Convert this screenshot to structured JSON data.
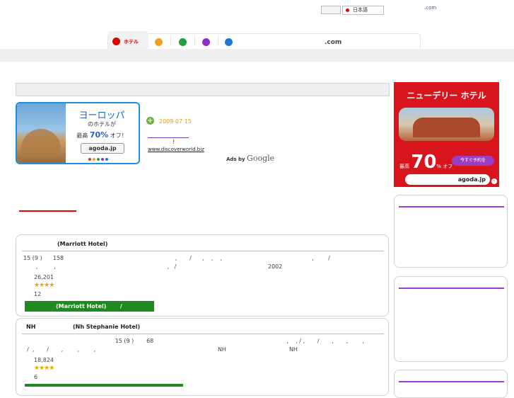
{
  "header": {
    "language_label": "日本語",
    "top_link": ".com"
  },
  "tabs": {
    "active_label": "ホテル",
    "items": [
      {
        "name": "hotel-tab",
        "color": "#e00000"
      },
      {
        "name": "tab-orange",
        "color": "#f0a020"
      },
      {
        "name": "tab-green",
        "color": "#20a040"
      },
      {
        "name": "tab-purple",
        "color": "#9030c0"
      },
      {
        "name": "tab-blue",
        "color": "#1e78d8"
      }
    ],
    "domain_text": ".com"
  },
  "banner": {
    "title": "ヨーロッパ",
    "line1": "のホテルが",
    "line2_prefix": "最高",
    "line2_percent": "70%",
    "line2_suffix": "オフ！",
    "button": "agoda.jp",
    "dot_colors": [
      "#e03030",
      "#f0a020",
      "#20a040",
      "#9030c0",
      "#1e78d8"
    ]
  },
  "ad": {
    "plus": "+",
    "date": "2009 07 15",
    "exclaim": "!",
    "url": "www.discoverworld.biz",
    "ads_by": "Ads by",
    "google": "Google"
  },
  "hotels": [
    {
      "name": "(Marriott Hotel)",
      "line1": "15 (9 )      158                                                              ,       /      ,    ,    ,                                                  ,        /",
      "line2": "       ,         ,                                                              ,   /                                                   2002",
      "reviews": "26,201",
      "stars": "★★★★",
      "count": "12",
      "bar": "(Marriott Hotel)       /                     /"
    },
    {
      "prefix": "NH",
      "name": "(Nh Stephanie Hotel)",
      "line1": "                                                   15 (9 )       68                                                                          ,    , / ,       /       ,       ,        ,                                  ,        ,",
      "line2": "  /  ,       /       ,        ,        ,                                                                    NH                                   NH",
      "reviews": "18,824",
      "stars": "★★★★",
      "count": "6"
    }
  ],
  "side_ad": {
    "title": "ニューデリー ホテル",
    "prefix": "最高",
    "percent": "70",
    "pct_sign": "%",
    "off": "オフ",
    "button": "今すぐ予約を",
    "footer": "agoda.jp",
    "info": "i"
  }
}
